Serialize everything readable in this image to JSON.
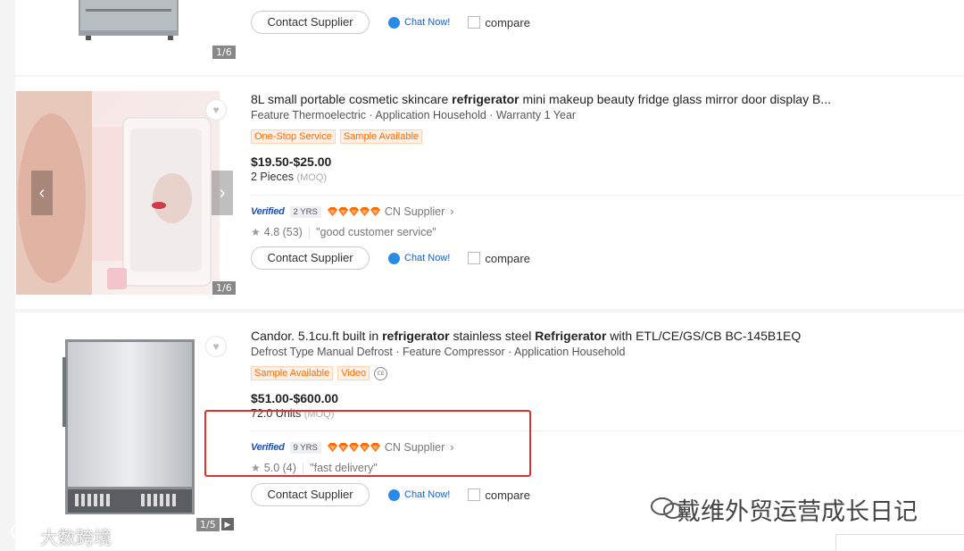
{
  "products": [
    {
      "image_counter": "1/6",
      "actions": {
        "contact": "Contact Supplier",
        "chat": "Chat Now!",
        "compare": "compare"
      }
    },
    {
      "title_parts": [
        {
          "text": "8L small portable cosmetic skincare ",
          "bold": false
        },
        {
          "text": "refrigerator",
          "bold": true
        },
        {
          "text": " mini makeup beauty fridge glass mirror door display B...",
          "bold": false
        }
      ],
      "attributes": "Feature Thermoelectric · Application Household · Warranty 1 Year",
      "tags": [
        "One-Stop Service",
        "Sample Available"
      ],
      "price": "$19.50-$25.00",
      "moq_value": "2 Pieces",
      "moq_label": "(MOQ)",
      "verified": "Verified",
      "years": "2 YRS",
      "supplier_type": "CN Supplier",
      "rating": "4.8 (53)",
      "review": "\"good customer service\"",
      "image_counter": "1/6",
      "actions": {
        "contact": "Contact Supplier",
        "chat": "Chat Now!",
        "compare": "compare"
      }
    },
    {
      "title_parts": [
        {
          "text": "Candor. 5.1cu.ft built in ",
          "bold": false
        },
        {
          "text": "refrigerator",
          "bold": true
        },
        {
          "text": " stainless steel ",
          "bold": false
        },
        {
          "text": "Refrigerator",
          "bold": true
        },
        {
          "text": " with ETL/CE/GS/CB BC-145B1EQ",
          "bold": false
        }
      ],
      "attributes": "Defrost Type Manual Defrost · Feature Compressor · Application Household",
      "tags": [
        "Sample Available",
        "Video"
      ],
      "price": "$51.00-$600.00",
      "moq_value": "72.0 Units",
      "moq_label": "(MOQ)",
      "verified": "Verified",
      "years": "9 YRS",
      "supplier_type": "CN Supplier",
      "rating": "5.0 (4)",
      "review": "\"fast delivery\"",
      "image_counter": "1/5",
      "actions": {
        "contact": "Contact Supplier",
        "chat": "Chat Now!",
        "compare": "compare"
      }
    }
  ],
  "watermarks": {
    "right": "戴维外贸运营成长日记",
    "left": "大数跨境"
  },
  "colors": {
    "accent": "#ff6a00",
    "verified": "#1a4fc4",
    "highlight_box": "#e0302c",
    "chat": "#2a8be6"
  }
}
